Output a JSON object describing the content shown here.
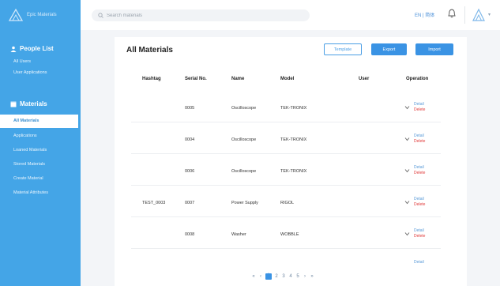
{
  "brand": {
    "name": "Epic Materials"
  },
  "topbar": {
    "search_placeholder": "Search materials",
    "language": "EN | 简体",
    "bell_icon": "bell-icon",
    "avatar_icon": "user-avatar-icon"
  },
  "sidebar": {
    "people_section": "People List",
    "people_items": [
      {
        "label": "All Users"
      },
      {
        "label": "User Applications"
      }
    ],
    "materials_section": "Materials",
    "material_items": [
      {
        "label": "All Materials",
        "active": true
      },
      {
        "label": "Applications"
      },
      {
        "label": "Loaned Materials"
      },
      {
        "label": "Stored Materials"
      },
      {
        "label": "Create Material"
      },
      {
        "label": "Material Attributes"
      }
    ]
  },
  "main": {
    "title": "All Materials",
    "buttons": {
      "template": "Template",
      "export": "Export",
      "import": "Import"
    },
    "columns": [
      "Hashtag",
      "Serial No.",
      "Name",
      "Model",
      "User",
      "Operation"
    ],
    "rows": [
      {
        "hashtag": "",
        "serial": "0005",
        "name": "Oscilloscope",
        "model": "TEK-TRONIX",
        "user": "",
        "detail": "Detail",
        "delete": "Delete"
      },
      {
        "hashtag": "",
        "serial": "0004",
        "name": "Oscilloscope",
        "model": "TEK-TRONIX",
        "user": "",
        "detail": "Detail",
        "delete": "Delete"
      },
      {
        "hashtag": "",
        "serial": "0006",
        "name": "Oscilloscope",
        "model": "TEK-TRONIX",
        "user": "",
        "detail": "Detail",
        "delete": "Delete"
      },
      {
        "hashtag": "TEST_0003",
        "serial": "0007",
        "name": "Power Supply",
        "model": "RIGOL",
        "user": "",
        "detail": "Detail",
        "delete": "Delete"
      },
      {
        "hashtag": "",
        "serial": "0008",
        "name": "Washer",
        "model": "WOBBLE",
        "user": "",
        "detail": "Detail",
        "delete": "Delete"
      }
    ],
    "partial_row": {
      "detail": "Detail"
    }
  },
  "pagination": {
    "first": "«",
    "prev": "‹",
    "pages": [
      "1",
      "2",
      "3",
      "4",
      "5"
    ],
    "current": "1",
    "next": "›",
    "last": "»"
  },
  "colors": {
    "sidebar": "#44a5e7",
    "primary": "#3a93e4",
    "danger": "#e03a3a",
    "link": "#5a9ad8"
  }
}
